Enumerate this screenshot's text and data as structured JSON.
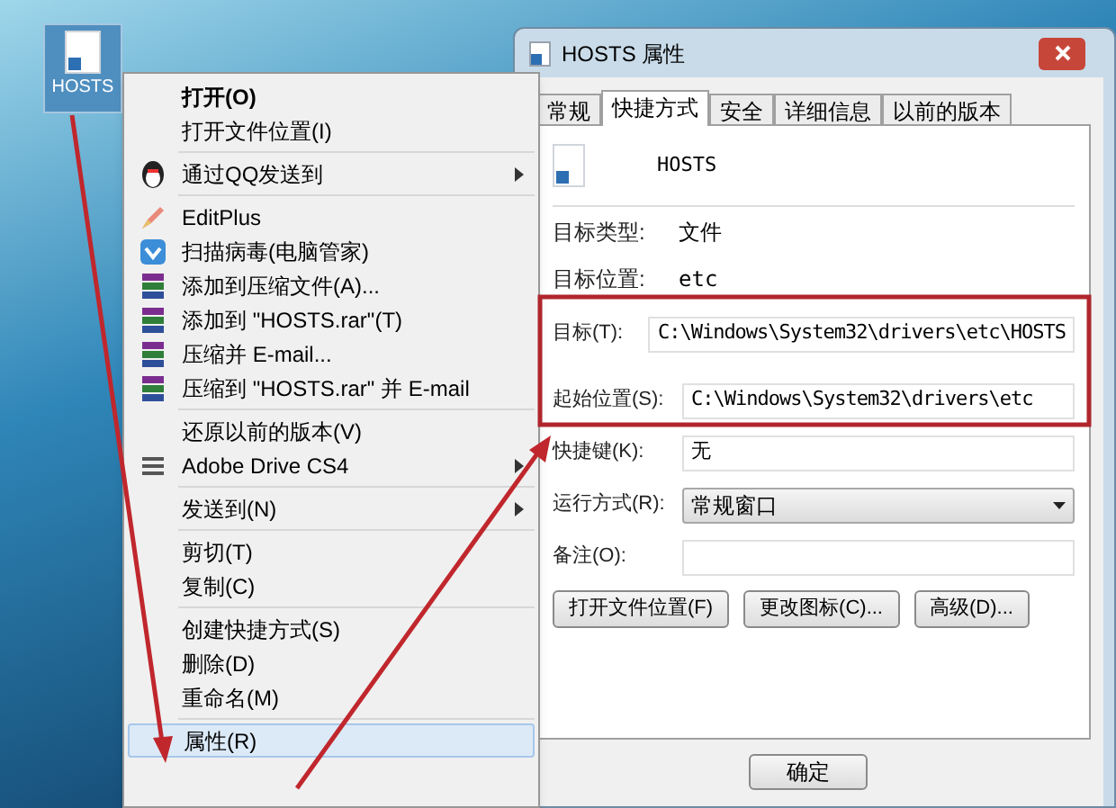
{
  "desktop_icon": {
    "label": "HOSTS"
  },
  "context_menu": {
    "items": [
      {
        "kind": "item",
        "label": "打开(O)",
        "bold": true,
        "submenu": false,
        "selected": false
      },
      {
        "kind": "item",
        "label": "打开文件位置(I)",
        "bold": false,
        "submenu": false,
        "selected": false
      },
      {
        "kind": "separator"
      },
      {
        "kind": "item",
        "label": "通过QQ发送到",
        "bold": false,
        "submenu": true,
        "selected": false
      },
      {
        "kind": "separator"
      },
      {
        "kind": "item",
        "label": "EditPlus",
        "bold": false,
        "submenu": false,
        "selected": false
      },
      {
        "kind": "item",
        "label": "扫描病毒(电脑管家)",
        "bold": false,
        "submenu": false,
        "selected": false
      },
      {
        "kind": "item",
        "label": "添加到压缩文件(A)...",
        "bold": false,
        "submenu": false,
        "selected": false
      },
      {
        "kind": "item",
        "label": "添加到 \"HOSTS.rar\"(T)",
        "bold": false,
        "submenu": false,
        "selected": false
      },
      {
        "kind": "item",
        "label": "压缩并 E-mail...",
        "bold": false,
        "submenu": false,
        "selected": false
      },
      {
        "kind": "item",
        "label": "压缩到 \"HOSTS.rar\" 并 E-mail",
        "bold": false,
        "submenu": false,
        "selected": false
      },
      {
        "kind": "separator"
      },
      {
        "kind": "item",
        "label": "还原以前的版本(V)",
        "bold": false,
        "submenu": false,
        "selected": false
      },
      {
        "kind": "item",
        "label": "Adobe Drive CS4",
        "bold": false,
        "submenu": true,
        "selected": false
      },
      {
        "kind": "separator"
      },
      {
        "kind": "item",
        "label": "发送到(N)",
        "bold": false,
        "submenu": true,
        "selected": false
      },
      {
        "kind": "separator"
      },
      {
        "kind": "item",
        "label": "剪切(T)",
        "bold": false,
        "submenu": false,
        "selected": false
      },
      {
        "kind": "item",
        "label": "复制(C)",
        "bold": false,
        "submenu": false,
        "selected": false
      },
      {
        "kind": "separator"
      },
      {
        "kind": "item",
        "label": "创建快捷方式(S)",
        "bold": false,
        "submenu": false,
        "selected": false
      },
      {
        "kind": "item",
        "label": "删除(D)",
        "bold": false,
        "submenu": false,
        "selected": false
      },
      {
        "kind": "item",
        "label": "重命名(M)",
        "bold": false,
        "submenu": false,
        "selected": false
      },
      {
        "kind": "separator"
      },
      {
        "kind": "item",
        "label": "属性(R)",
        "bold": false,
        "submenu": false,
        "selected": true
      }
    ]
  },
  "dialog": {
    "title": "HOSTS 属性",
    "tabs": [
      {
        "label": "常规",
        "selected": false
      },
      {
        "label": "快捷方式",
        "selected": true
      },
      {
        "label": "安全",
        "selected": false
      },
      {
        "label": "详细信息",
        "selected": false
      },
      {
        "label": "以前的版本",
        "selected": false
      }
    ],
    "file_name": "HOSTS",
    "info": [
      {
        "label": "目标类型:",
        "value": "文件"
      },
      {
        "label": "目标位置:",
        "value": "etc"
      }
    ],
    "fields": [
      {
        "kind": "text",
        "label": "目标(T):",
        "value": "C:\\Windows\\System32\\drivers\\etc\\HOSTS"
      },
      {
        "kind": "text",
        "label": "起始位置(S):",
        "value": "C:\\Windows\\System32\\drivers\\etc"
      },
      {
        "kind": "text",
        "label": "快捷键(K):",
        "value": "无"
      },
      {
        "kind": "select",
        "label": "运行方式(R):",
        "value": "常规窗口"
      },
      {
        "kind": "text",
        "label": "备注(O):"
      }
    ],
    "buttons": [
      "打开文件位置(F)",
      "更改图标(C)...",
      "高级(D)..."
    ],
    "footer_buttons": [
      "确定"
    ]
  }
}
